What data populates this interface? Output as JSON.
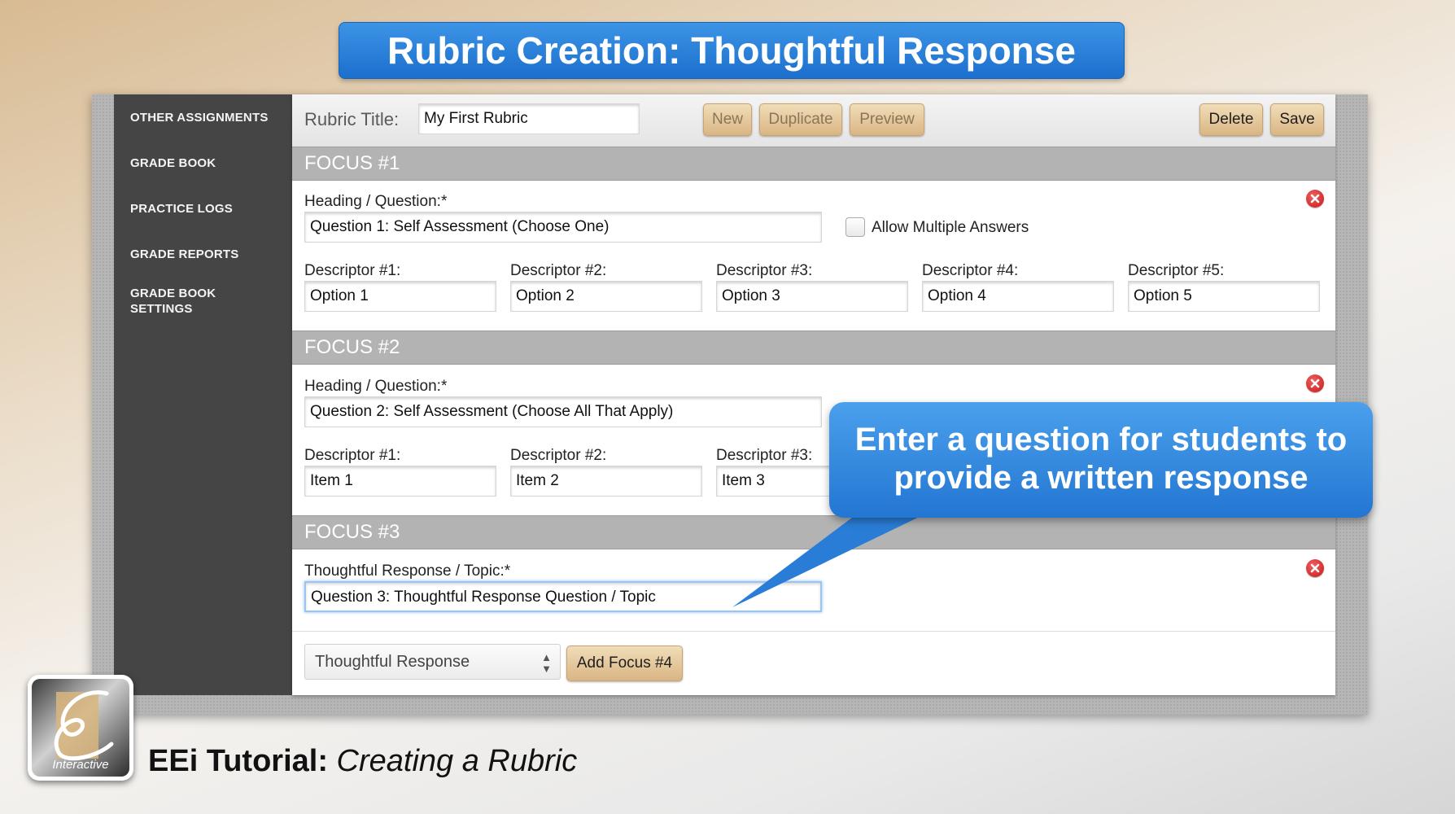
{
  "banner_title": "Rubric Creation: Thoughtful Response",
  "sidebar": {
    "items": [
      {
        "label": "OTHER ASSIGNMENTS"
      },
      {
        "label": "GRADE BOOK"
      },
      {
        "label": "PRACTICE LOGS"
      },
      {
        "label": "GRADE REPORTS"
      },
      {
        "label": "GRADE BOOK SETTINGS"
      }
    ]
  },
  "toolbar": {
    "rubric_title_label": "Rubric Title:",
    "rubric_title_value": "My First Rubric",
    "new_label": "New",
    "duplicate_label": "Duplicate",
    "preview_label": "Preview",
    "delete_label": "Delete",
    "save_label": "Save"
  },
  "focus1": {
    "header": "FOCUS #1",
    "question_label": "Heading / Question:*",
    "question_value": "Question 1: Self Assessment (Choose One)",
    "allow_multiple_label": "Allow Multiple Answers",
    "descriptors": [
      {
        "label": "Descriptor #1:",
        "value": "Option 1"
      },
      {
        "label": "Descriptor #2:",
        "value": "Option 2"
      },
      {
        "label": "Descriptor #3:",
        "value": "Option 3"
      },
      {
        "label": "Descriptor #4:",
        "value": "Option 4"
      },
      {
        "label": "Descriptor #5:",
        "value": "Option 5"
      }
    ]
  },
  "focus2": {
    "header": "FOCUS #2",
    "question_label": "Heading / Question:*",
    "question_value": "Question 2: Self Assessment (Choose All That Apply)",
    "descriptors": [
      {
        "label": "Descriptor #1:",
        "value": "Item 1"
      },
      {
        "label": "Descriptor #2:",
        "value": "Item 2"
      },
      {
        "label": "Descriptor #3:",
        "value": "Item 3"
      }
    ]
  },
  "focus3": {
    "header": "FOCUS #3",
    "topic_label": "Thoughtful Response / Topic:*",
    "topic_value": "Question 3: Thoughtful Response Question / Topic"
  },
  "add_focus": {
    "type_selected": "Thoughtful Response",
    "button_label": "Add Focus #4"
  },
  "callout_text": "Enter a question for students to provide a written response",
  "logo_word": "Interactive",
  "footer": {
    "bold": "EEi Tutorial:",
    "italic": "Creating a Rubric"
  },
  "colors": {
    "banner": "#2a82da",
    "sidebar": "#454545",
    "focus_bar": "#b3b3b3",
    "button": "#e4c59a",
    "remove_icon": "#d62424"
  }
}
